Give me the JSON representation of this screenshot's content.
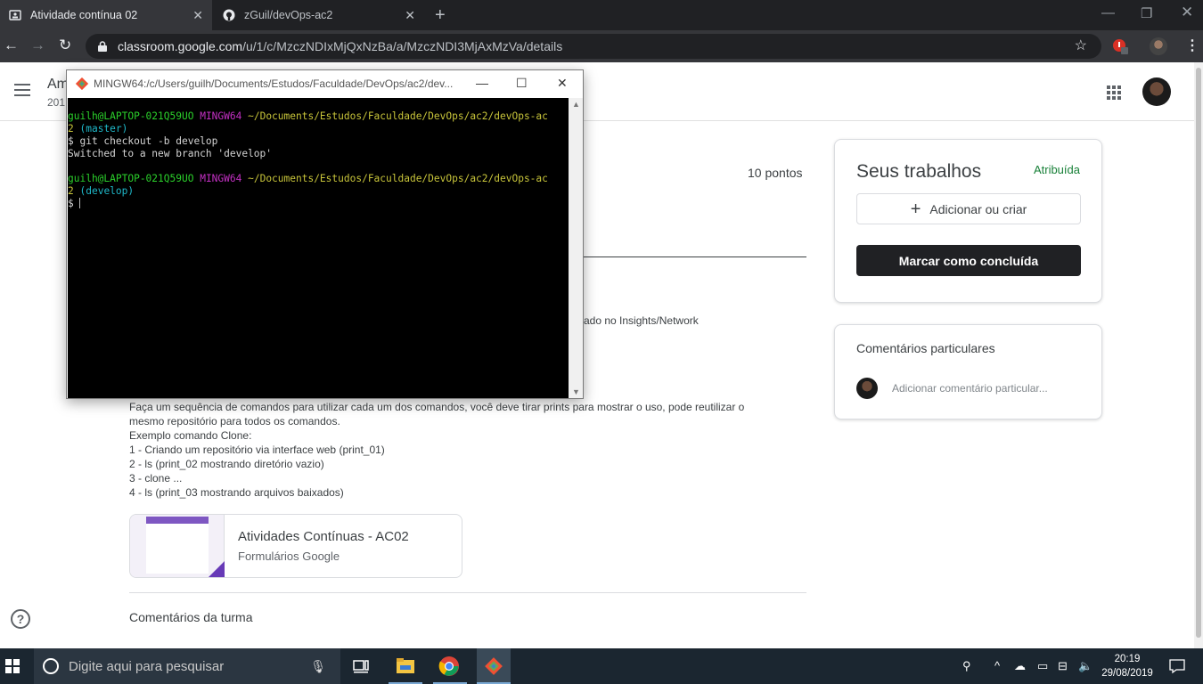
{
  "browser": {
    "tabs": [
      {
        "title": "Atividade contínua 02",
        "active": true
      },
      {
        "title": "zGuil/devOps-ac2",
        "active": false
      }
    ],
    "url_host": "classroom.google.com",
    "url_path": "/u/1/c/MzczNDIxMjQxNzBa/a/MzczNDI3MjAxMzVa/details"
  },
  "classroom": {
    "class_name_partial": "Am",
    "class_sub_partial": "201",
    "points": "10 pontos",
    "partial_text": "ado no Insights/Network",
    "description": [
      "Faça um sequência de comandos para utilizar cada um dos comandos, você deve tirar prints para mostrar o uso, pode reutilizar o",
      "mesmo repositório para todos os comandos.",
      "Exemplo comando Clone:",
      "1 - Criando um repositório via interface web (print_01)",
      "2 - ls (print_02 mostrando diretório vazio)",
      "3 - clone ...",
      "4 - ls (print_03 mostrando arquivos baixados)"
    ],
    "attachment": {
      "title": "Atividades Contínuas - AC02",
      "subtitle": "Formulários Google"
    },
    "class_comments": "Comentários da turma",
    "your_work": {
      "title": "Seus trabalhos",
      "status": "Atribuída",
      "add_label": "Adicionar ou criar",
      "done_label": "Marcar como concluída"
    },
    "private_comments": {
      "title": "Comentários particulares",
      "placeholder": "Adicionar comentário particular..."
    },
    "help_icon": "?"
  },
  "terminal": {
    "title": "MINGW64:/c/Users/guilh/Documents/Estudos/Faculdade/DevOps/ac2/dev...",
    "lines": [
      {
        "user": "guilh@LAPTOP-021Q59UO",
        "shell": "MINGW64",
        "path": "~/Documents/Estudos/Faculdade/DevOps/ac2/devOps-ac"
      },
      {
        "cont": "2",
        "branch": "(master)"
      },
      {
        "text": "$ git checkout -b develop"
      },
      {
        "text": "Switched to a new branch 'develop'"
      },
      {
        "text": ""
      },
      {
        "user": "guilh@LAPTOP-021Q59UO",
        "shell": "MINGW64",
        "path": "~/Documents/Estudos/Faculdade/DevOps/ac2/devOps-ac"
      },
      {
        "cont": "2",
        "branch": "(develop)"
      },
      {
        "text": "$"
      }
    ]
  },
  "taskbar": {
    "search_placeholder": "Digite aqui para pesquisar",
    "time": "20:19",
    "date": "29/08/2019"
  },
  "colors": {
    "accent_green": "#188038",
    "dark_button": "#202124",
    "taskbar": "#1b2630"
  }
}
